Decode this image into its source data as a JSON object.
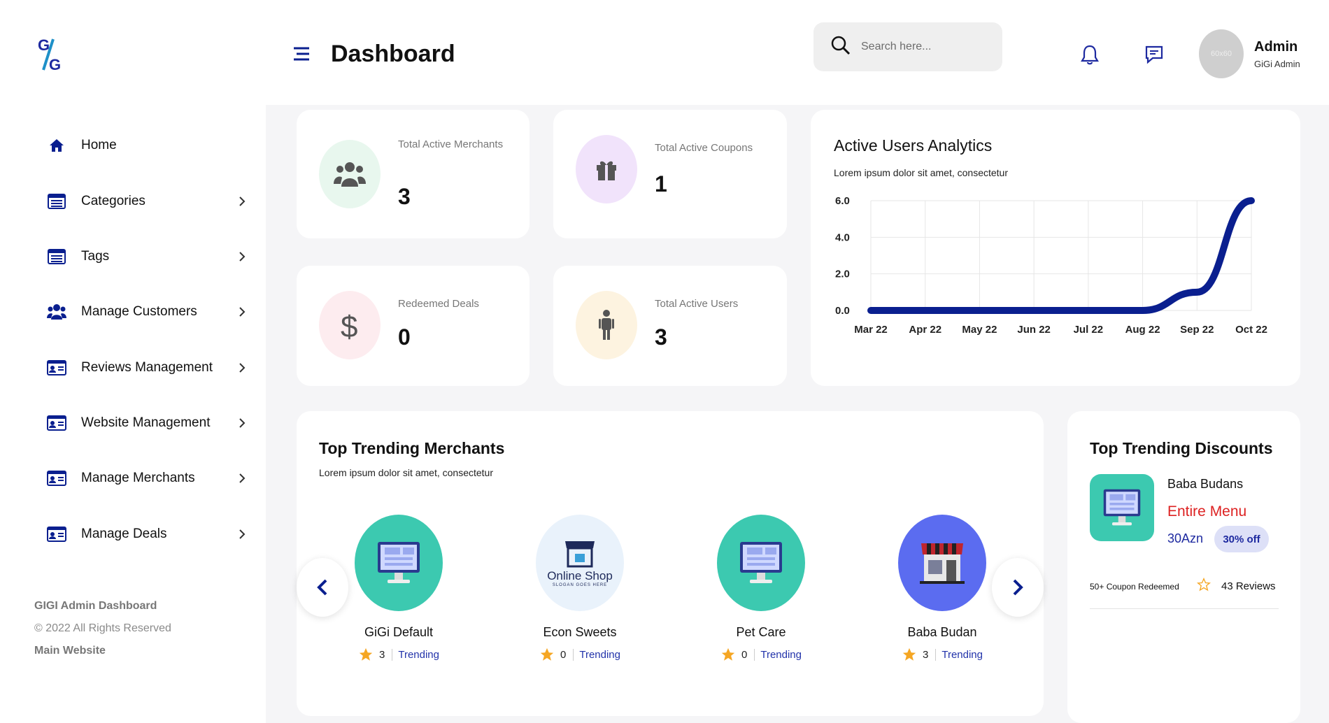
{
  "header": {
    "title": "Dashboard",
    "search_placeholder": "Search here...",
    "avatar_text": "60x60",
    "user_name": "Admin",
    "user_role": "GiGi Admin"
  },
  "sidebar": {
    "items": [
      {
        "label": "Home",
        "icon": "home-icon"
      },
      {
        "label": "Categories",
        "icon": "list-icon"
      },
      {
        "label": "Tags",
        "icon": "list-icon"
      },
      {
        "label": "Manage Customers",
        "icon": "users-icon"
      },
      {
        "label": "Reviews Management",
        "icon": "id-card-icon"
      },
      {
        "label": "Website Management",
        "icon": "id-card-icon"
      },
      {
        "label": "Manage Merchants",
        "icon": "id-card-icon"
      },
      {
        "label": "Manage Deals",
        "icon": "id-card-icon"
      }
    ],
    "footer_title": "GIGI Admin Dashboard",
    "footer_copyright": "© 2022 All Rights Reserved",
    "footer_link": "Main Website"
  },
  "stats": [
    {
      "label": "Total Active Merchants",
      "value": "3",
      "icon": "users-icon",
      "bg": "#e8f7ee"
    },
    {
      "label": "Total Active Coupons",
      "value": "1",
      "icon": "gift-icon",
      "bg": "#f1e3fb"
    },
    {
      "label": "Redeemed Deals",
      "value": "0",
      "icon": "dollar-icon",
      "bg": "#fdecef"
    },
    {
      "label": "Total Active Users",
      "value": "3",
      "icon": "person-icon",
      "bg": "#fdf3e0"
    }
  ],
  "analytics": {
    "title": "Active Users Analytics",
    "subtitle": "Lorem ipsum dolor sit amet, consectetur"
  },
  "chart_data": {
    "type": "line",
    "title": "Active Users Analytics",
    "x": [
      "Mar 22",
      "Apr 22",
      "May 22",
      "Jun 22",
      "Jul 22",
      "Aug 22",
      "Sep 22",
      "Oct 22"
    ],
    "series": [
      {
        "values": [
          0,
          0,
          0,
          0,
          0,
          0,
          1,
          6
        ]
      }
    ],
    "y_ticks": [
      "0.0",
      "2.0",
      "4.0",
      "6.0"
    ],
    "ylim": [
      0,
      6
    ],
    "grid": true,
    "color": "#0a1f8f"
  },
  "merchants": {
    "title": "Top Trending Merchants",
    "subtitle": "Lorem ipsum dolor sit amet, consectetur",
    "items": [
      {
        "name": "GiGi Default",
        "rating": "3",
        "trend": "Trending",
        "image": "shop-monitor-icon",
        "bg": "#3cc9b0"
      },
      {
        "name": "Econ Sweets",
        "rating": "0",
        "trend": "Trending",
        "image": "online-shop-logo",
        "bg": "#e9f2fb",
        "logo_text": "Online Shop",
        "logo_sub": "SLOGAN GOES HERE"
      },
      {
        "name": "Pet Care",
        "rating": "0",
        "trend": "Trending",
        "image": "shop-monitor-icon",
        "bg": "#3cc9b0"
      },
      {
        "name": "Baba Budan",
        "rating": "3",
        "trend": "Trending",
        "image": "storefront-icon",
        "bg": "#5b6cf0"
      }
    ]
  },
  "discounts": {
    "title": "Top Trending Discounts",
    "merchant": "Baba Budans",
    "item": "Entire Menu",
    "price": "30Azn",
    "badge": "30% off",
    "redeemed": "50+ Coupon Redeemed",
    "reviews": "43 Reviews"
  },
  "colors": {
    "accent": "#0a1f8f",
    "star": "#f5a623",
    "link": "#2233aa",
    "sale_red": "#dd2222"
  }
}
